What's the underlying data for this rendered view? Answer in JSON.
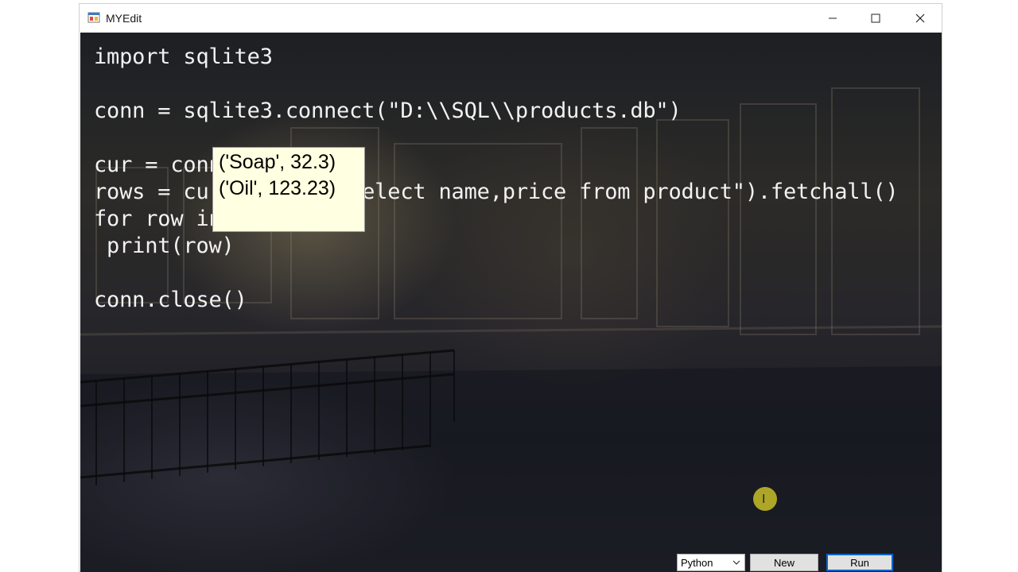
{
  "window": {
    "title": "MYEdit",
    "controls": {
      "minimize": "minimize",
      "maximize": "maximize",
      "close": "close"
    }
  },
  "editor": {
    "lines": [
      "import sqlite3",
      "",
      "conn = sqlite3.connect(\"D:\\\\SQL\\\\products.db\")",
      "",
      "cur = conn.cursor()",
      "rows = cur.execute(\"select name,price from product\").fetchall()",
      "for row in rows:",
      " print(row)",
      "",
      "conn.close()"
    ]
  },
  "output_tooltip": {
    "lines": [
      "('Soap', 32.3)",
      "('Oil', 123.23)"
    ]
  },
  "footer": {
    "language": "Python",
    "new_label": "New",
    "run_label": "Run"
  },
  "icons": {
    "app": "app-icon",
    "minimize": "minimize-icon",
    "maximize": "maximize-icon",
    "close": "close-icon",
    "dropdown": "chevron-down-icon"
  }
}
